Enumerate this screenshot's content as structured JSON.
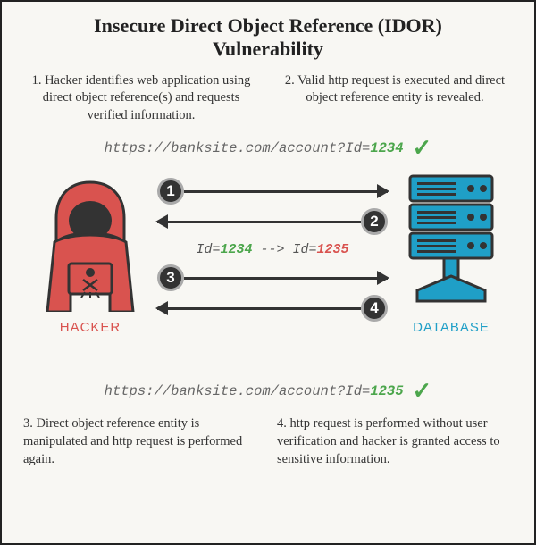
{
  "title": "Insecure Direct Object Reference (IDOR) Vulnerability",
  "step1": "1. Hacker identifies web application using direct object reference(s) and requests verified information.",
  "step2": "2. Valid http request is executed and direct object reference entity is revealed.",
  "step3": "3. Direct object reference entity is manipulated and http request is performed again.",
  "step4": "4. http request is performed without user verification and hacker is granted access to sensitive information.",
  "url_base": "https://banksite.com/account?Id=",
  "id_valid": "1234",
  "id_tamper": "1235",
  "arrow_sep": " --> ",
  "id_prefix": "Id=",
  "hacker_label": "HACKER",
  "db_label": "DATABASE",
  "n1": "1",
  "n2": "2",
  "n3": "3",
  "n4": "4"
}
